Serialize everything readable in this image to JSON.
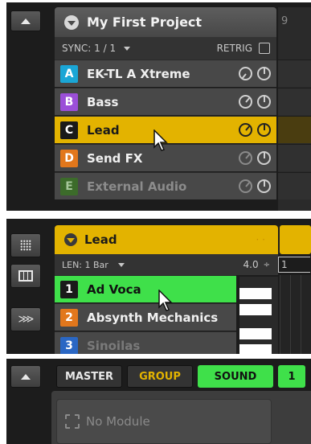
{
  "panel1": {
    "project_title": "My First Project",
    "sync_label": "SYNC: 1 / 1",
    "retrig_label": "RETRIG",
    "column_number": "9",
    "groups": [
      {
        "letter": "A",
        "name": "EK-TL A Xtreme",
        "color": "#1aa6d6"
      },
      {
        "letter": "B",
        "name": "Bass",
        "color": "#9b4fd8"
      },
      {
        "letter": "C",
        "name": "Lead",
        "color": "#1a1a1a",
        "selected": true
      },
      {
        "letter": "D",
        "name": "Send FX",
        "color": "#e2771c"
      },
      {
        "letter": "E",
        "name": "External Audio",
        "color": "#3c6b2a",
        "dimmed": true
      }
    ]
  },
  "panel2": {
    "group_title": "Lead",
    "length_label": "LEN: 1 Bar",
    "zoom_value": "4.0",
    "spinner_symbol": "÷",
    "position_value": "1",
    "sounds": [
      {
        "number": "1",
        "name": "Ad Voca",
        "color": "#1a1a1a",
        "selected": true
      },
      {
        "number": "2",
        "name": "Absynth Mechanics",
        "color": "#e2771c"
      },
      {
        "number": "3",
        "name": "Sinoilas",
        "color": "#2a67c4"
      }
    ]
  },
  "panel3": {
    "tabs": {
      "master": "MASTER",
      "group": "GROUP",
      "sound": "SOUND",
      "sound_number": "1"
    },
    "module_placeholder": "No Module"
  },
  "colors": {
    "group_accent": "#e3b300",
    "sound_accent": "#3fe04a",
    "panel_bg": "#1c1c1c"
  }
}
